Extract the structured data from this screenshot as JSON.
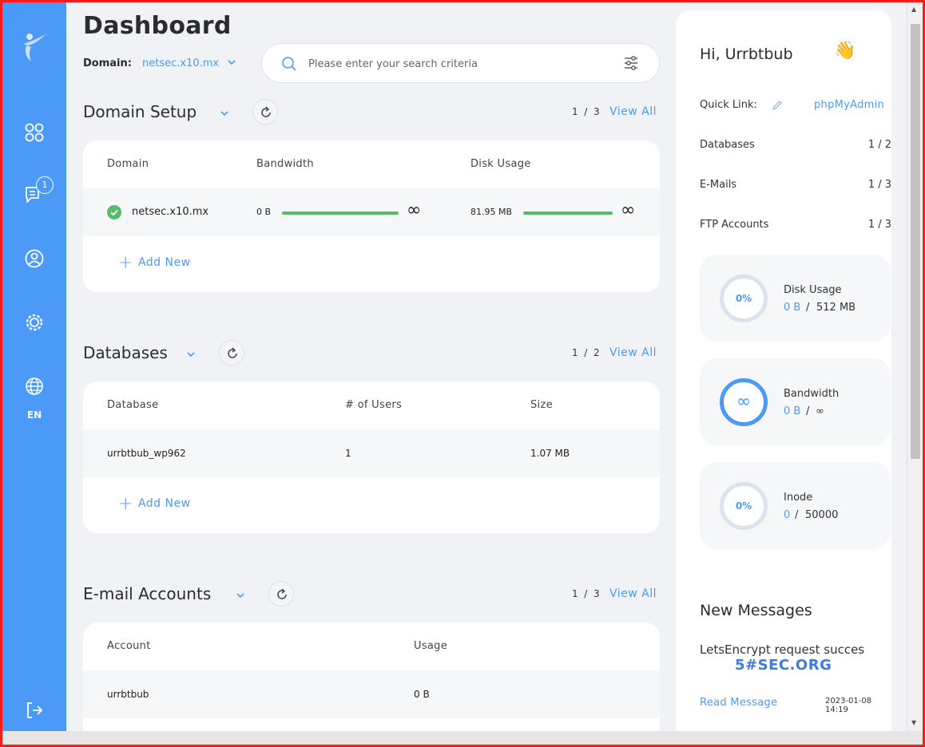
{
  "page": {
    "title": "Dashboard"
  },
  "domain": {
    "label": "Domain:",
    "value": "netsec.x10.mx"
  },
  "search": {
    "placeholder": "Please enter your search criteria"
  },
  "sidebar": {
    "language": "EN",
    "notifications_count": "1"
  },
  "domain_setup": {
    "title": "Domain Setup",
    "page_current": "1",
    "page_sep": "/",
    "page_total": "3",
    "view_all": "View All",
    "columns": [
      "Domain",
      "Bandwidth",
      "Disk Usage"
    ],
    "rows": [
      {
        "domain": "netsec.x10.mx",
        "bandwidth": "0 B",
        "bandwidth_limit": "∞",
        "disk": "81.95 MB",
        "disk_limit": "∞"
      }
    ],
    "add_new": "Add New"
  },
  "databases": {
    "title": "Databases",
    "page_current": "1",
    "page_sep": "/",
    "page_total": "2",
    "view_all": "View All",
    "columns": [
      "Database",
      "# of Users",
      "Size"
    ],
    "rows": [
      {
        "name": "urrbtbub_wp962",
        "users": "1",
        "size": "1.07 MB"
      }
    ],
    "add_new": "Add New"
  },
  "email_accounts": {
    "title": "E-mail Accounts",
    "page_current": "1",
    "page_sep": "/",
    "page_total": "3",
    "view_all": "View All",
    "columns": [
      "Account",
      "Usage"
    ],
    "rows": [
      {
        "account": "urrbtbub",
        "usage": "0 B"
      }
    ]
  },
  "right_panel": {
    "greeting": "Hi, Urrbtbub",
    "greeting_emoji": "👋",
    "quick_link_label": "Quick Link:",
    "quick_link": "phpMyAdmin",
    "stats": [
      {
        "label": "Databases",
        "value": "1 / 2"
      },
      {
        "label": "E-Mails",
        "value": "1 / 3"
      },
      {
        "label": "FTP Accounts",
        "value": "1 / 3"
      }
    ],
    "resources": [
      {
        "title": "Disk Usage",
        "percent": "0%",
        "used": "0 B",
        "sep": "/",
        "limit": "512 MB"
      },
      {
        "title": "Bandwidth",
        "percent": "∞",
        "used": "0 B",
        "sep": "/",
        "limit": "∞"
      },
      {
        "title": "Inode",
        "percent": "0%",
        "used": "0",
        "sep": "/",
        "limit": "50000"
      }
    ],
    "messages": {
      "title": "New Messages",
      "body": "LetsEncrypt request succes",
      "read_label": "Read Message",
      "date": "2023-01-08 14:19",
      "watermark": "5#SEC.ORG"
    }
  },
  "colors": {
    "accent": "#4b9af7",
    "success": "#57bb6c",
    "background": "#f0f2f5"
  }
}
